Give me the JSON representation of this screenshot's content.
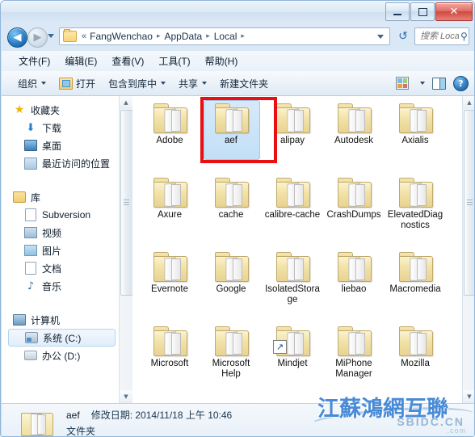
{
  "window": {
    "controls": {
      "minimize": "–",
      "maximize": "□",
      "close": "✕"
    }
  },
  "addressbar": {
    "back_arrow": "◀",
    "forward_arrow": "▶",
    "chevron": "«",
    "crumbs": [
      "FangWenchao",
      "AppData",
      "Local"
    ],
    "separator": "▸",
    "refresh_icon": "↺"
  },
  "search": {
    "placeholder": "搜索 Local",
    "icon": "⚲"
  },
  "menubar": {
    "items": [
      {
        "label": "文件(F)"
      },
      {
        "label": "编辑(E)"
      },
      {
        "label": "查看(V)"
      },
      {
        "label": "工具(T)"
      },
      {
        "label": "帮助(H)"
      }
    ]
  },
  "commandbar": {
    "organize": "组织",
    "open": "打开",
    "include_in_library": "包含到库中",
    "share": "共享",
    "new_folder": "新建文件夹",
    "help_glyph": "?"
  },
  "sidebar": {
    "favorites": {
      "label": "收藏夹",
      "items": [
        {
          "label": "下载"
        },
        {
          "label": "桌面"
        },
        {
          "label": "最近访问的位置"
        }
      ]
    },
    "libraries": {
      "label": "库",
      "items": [
        {
          "label": "Subversion"
        },
        {
          "label": "视频"
        },
        {
          "label": "图片"
        },
        {
          "label": "文档"
        },
        {
          "label": "音乐"
        }
      ]
    },
    "computer": {
      "label": "计算机",
      "items": [
        {
          "label": "系统 (C:)",
          "selected": true
        },
        {
          "label": "办公 (D:)",
          "selected": false
        }
      ]
    },
    "download_glyph": "⬇",
    "music_glyph": "♪"
  },
  "files": [
    {
      "name": "Adobe",
      "selected": false,
      "shortcut": false
    },
    {
      "name": "aef",
      "selected": true,
      "shortcut": false
    },
    {
      "name": "alipay",
      "selected": false,
      "shortcut": false
    },
    {
      "name": "Autodesk",
      "selected": false,
      "shortcut": false
    },
    {
      "name": "Axialis",
      "selected": false,
      "shortcut": false
    },
    {
      "name": "Axure",
      "selected": false,
      "shortcut": false
    },
    {
      "name": "cache",
      "selected": false,
      "shortcut": false
    },
    {
      "name": "calibre-cache",
      "selected": false,
      "shortcut": false
    },
    {
      "name": "CrashDumps",
      "selected": false,
      "shortcut": false
    },
    {
      "name": "ElevatedDiagnostics",
      "selected": false,
      "shortcut": false
    },
    {
      "name": "Evernote",
      "selected": false,
      "shortcut": false
    },
    {
      "name": "Google",
      "selected": false,
      "shortcut": false
    },
    {
      "name": "IsolatedStorage",
      "selected": false,
      "shortcut": false
    },
    {
      "name": "liebao",
      "selected": false,
      "shortcut": false
    },
    {
      "name": "Macromedia",
      "selected": false,
      "shortcut": false
    },
    {
      "name": "Microsoft",
      "selected": false,
      "shortcut": false
    },
    {
      "name": "Microsoft Help",
      "selected": false,
      "shortcut": false
    },
    {
      "name": "Mindjet",
      "selected": false,
      "shortcut": true
    },
    {
      "name": "MiPhone Manager",
      "selected": false,
      "shortcut": false
    },
    {
      "name": "Mozilla",
      "selected": false,
      "shortcut": false
    }
  ],
  "details": {
    "name": "aef",
    "modified": "修改日期: 2014/11/18 上午 10:46",
    "type": "文件夹"
  },
  "scrollbars": {
    "up_arrow": "▲",
    "down_arrow": "▼"
  },
  "watermark": {
    "cjk": "江蘇鴻網互聯",
    "latin": "SBIDC.CN",
    "domain": ".com"
  },
  "colors": {
    "accent": "#2a7fc9",
    "annotation": "#e81010",
    "selection": "#c3dff6",
    "folder": "#f3e3a8"
  }
}
